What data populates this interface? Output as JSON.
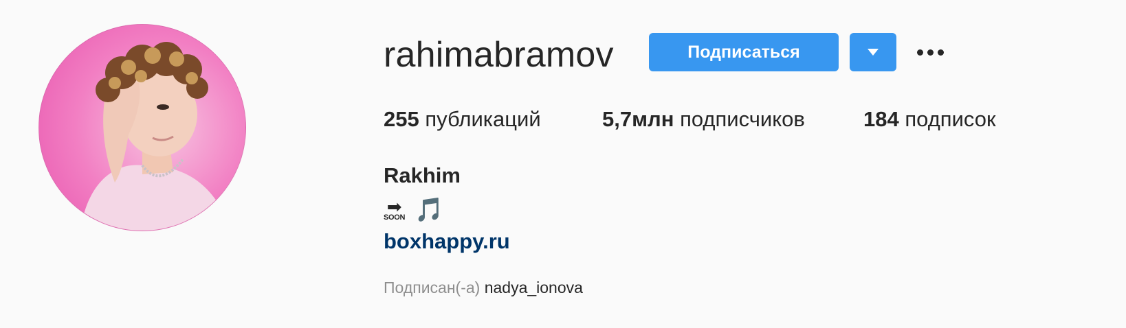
{
  "profile": {
    "username": "rahimabramov",
    "full_name": "Rakhim",
    "avatar_bg_color": "#f07ac0"
  },
  "actions": {
    "follow_label": "Подписаться",
    "dropdown_icon": "caret-down-icon",
    "more_icon": "more-options-icon",
    "accent_color": "#3897f0"
  },
  "stats": {
    "posts": {
      "count": "255",
      "label": "публикаций"
    },
    "followers": {
      "count": "5,7млн",
      "label": "подписчиков"
    },
    "following": {
      "count": "184",
      "label": "подписок"
    }
  },
  "bio": {
    "soon_arrow": "➡",
    "soon_text": "SOON",
    "music_note": "🎵",
    "link": "boxhappy.ru",
    "link_color": "#003569"
  },
  "followed_by": {
    "label": "Подписан(-а)",
    "user": "nadya_ionova"
  }
}
